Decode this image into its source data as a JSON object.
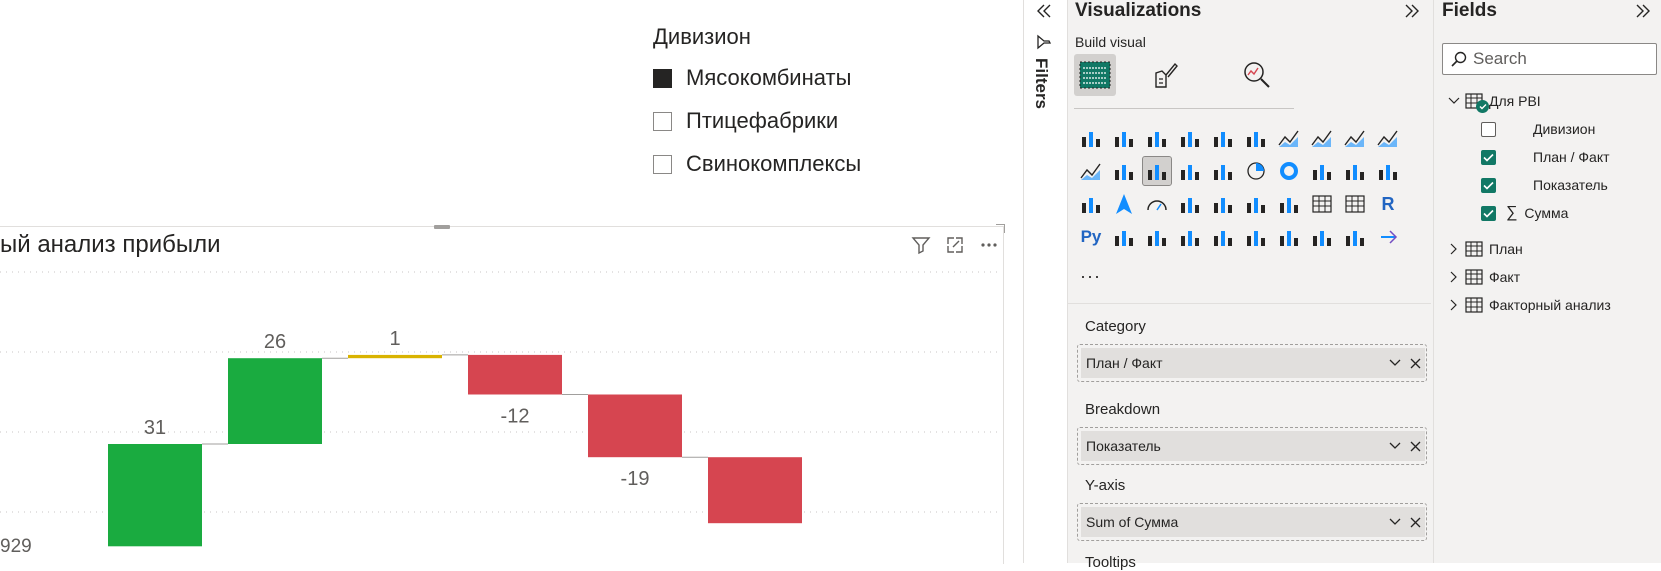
{
  "legend": {
    "title": "Дивизион",
    "items": [
      {
        "label": "Мясокомбинаты",
        "checked": true
      },
      {
        "label": "Птицефабрики",
        "checked": false
      },
      {
        "label": "Свинокомплексы",
        "checked": false
      }
    ]
  },
  "visual": {
    "title": "ый анализ прибыли",
    "icons": [
      "filter-icon",
      "focus-mode-icon",
      "more-options-icon"
    ]
  },
  "chart_data": {
    "type": "waterfall",
    "y_axis_visible_label": "929",
    "steps": [
      {
        "label": "31",
        "value": 31,
        "color": "#1aab40"
      },
      {
        "label": "26",
        "value": 26,
        "color": "#1aab40"
      },
      {
        "label": "1",
        "value": 1,
        "color": "#d9b300"
      },
      {
        "label": "-12",
        "value": -12,
        "color": "#d64550"
      },
      {
        "label": "-19",
        "value": -19,
        "color": "#d64550"
      },
      {
        "label": "",
        "value": -20,
        "color": "#d64550"
      }
    ],
    "gridlines": true,
    "colors": {
      "increase": "#1aab40",
      "decrease": "#d64550",
      "neutral": "#d9b300"
    }
  },
  "filters": {
    "label": "Filters"
  },
  "visualizations": {
    "title": "Visualizations",
    "build_visual": "Build visual",
    "tabs": [
      "build-visual-tab",
      "format-visual-tab",
      "analytics-tab"
    ],
    "more": "···",
    "wells": [
      {
        "label": "Category",
        "value": "План / Факт"
      },
      {
        "label": "Breakdown",
        "value": "Показатель"
      },
      {
        "label": "Y-axis",
        "value": "Sum of Сумма"
      },
      {
        "label": "Tooltips",
        "value": ""
      }
    ]
  },
  "fields": {
    "title": "Fields",
    "search_placeholder": "Search",
    "tables": [
      {
        "name": "Для PBI",
        "expanded": true,
        "items": [
          {
            "name": "Дивизион",
            "checked": false,
            "sigma": false
          },
          {
            "name": "План / Факт",
            "checked": true,
            "sigma": false
          },
          {
            "name": "Показатель",
            "checked": true,
            "sigma": false
          },
          {
            "name": "Сумма",
            "checked": true,
            "sigma": true
          }
        ]
      },
      {
        "name": "План",
        "expanded": false
      },
      {
        "name": "Факт",
        "expanded": false
      },
      {
        "name": "Факторный анализ",
        "expanded": false
      }
    ]
  }
}
